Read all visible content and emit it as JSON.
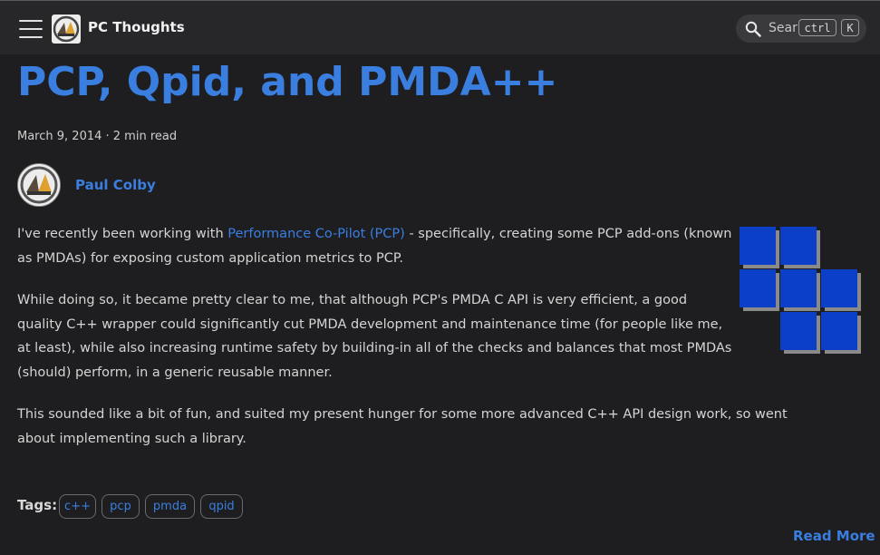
{
  "header": {
    "site_title": "PC Thoughts",
    "search_placeholder": "Sear",
    "shortcut_keys": [
      "ctrl",
      "K"
    ]
  },
  "post": {
    "title": "PCP, Qpid, and PMDA++",
    "meta": "March 9, 2014 · 2 min read",
    "author": "Paul Colby",
    "paragraphs": {
      "p1_before_link": "I've recently been working with ",
      "p1_link": "Performance Co-Pilot (PCP)",
      "p1_after_link": " - specifically, creating some PCP add-ons (known as PMDAs) for exposing custom application metrics to PCP.",
      "p2": "While doing so, it became pretty clear to me, that although PCP's PMDA C API is very efficient, a good quality C++ wrapper could significantly cut PMDA development and maintenance time (for people like me, at least), while also increasing runtime safety by building-in all of the checks and balances that most PMDAs (should) perform, in a generic reusable manner.",
      "p3": "This sounded like a bit of fun, and suited my present hunger for some more advanced C++ API design work, so went about implementing such a library."
    },
    "tags_label": "Tags:",
    "tags": [
      "c++",
      "pcp",
      "pmda",
      "qpid"
    ],
    "read_more": "Read More"
  },
  "colors": {
    "background": "#1e1e20",
    "navbar": "#27272a",
    "accent": "#3a7ee0",
    "pcp_logo_blue": "#0b3fc7"
  }
}
